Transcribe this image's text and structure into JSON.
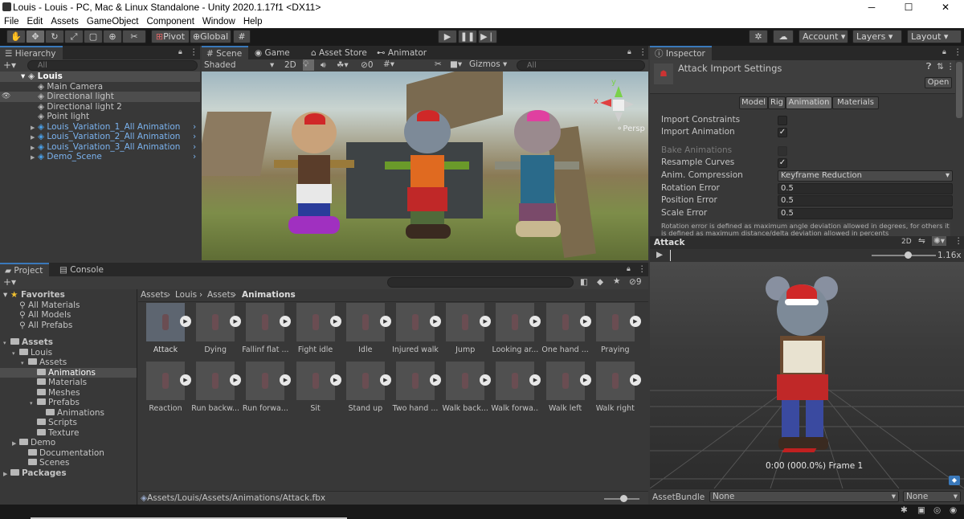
{
  "window": {
    "title": "Louis - Louis - PC, Mac & Linux Standalone - Unity 2020.1.17f1 <DX11>",
    "minimize": "─",
    "maximize": "☐",
    "close": "✕"
  },
  "menu": [
    "File",
    "Edit",
    "Assets",
    "GameObject",
    "Component",
    "Window",
    "Help"
  ],
  "toolbar": {
    "pivot": "Pivot",
    "global": "Global",
    "account": "Account",
    "layers": "Layers",
    "layout": "Layout"
  },
  "hierarchy": {
    "tab": "Hierarchy",
    "search_placeholder": "All",
    "root": "Louis",
    "items": [
      {
        "label": "Main Camera",
        "prefab": false,
        "expand": false
      },
      {
        "label": "Directional light",
        "prefab": false,
        "expand": false
      },
      {
        "label": "Directional light 2",
        "prefab": false,
        "expand": false
      },
      {
        "label": "Point light",
        "prefab": false,
        "expand": false
      },
      {
        "label": "Louis_Variation_1_All Animation",
        "prefab": true,
        "expand": true
      },
      {
        "label": "Louis_Variation_2_All Animation",
        "prefab": true,
        "expand": true
      },
      {
        "label": "Louis_Variation_3_All Animation",
        "prefab": true,
        "expand": true
      },
      {
        "label": "Demo_Scene",
        "prefab": true,
        "expand": true
      }
    ]
  },
  "scene": {
    "tabs": [
      "Scene",
      "Game",
      "Asset Store",
      "Animator"
    ],
    "shading": "Shaded",
    "mode2d": "2D",
    "hidden_count": "0",
    "gizmos": "Gizmos",
    "search_placeholder": "All",
    "axis_y": "y",
    "axis_x": "x",
    "persp": "Persp"
  },
  "project": {
    "tabs": [
      "Project",
      "Console"
    ],
    "hidden_count": "9",
    "favorites": {
      "label": "Favorites",
      "items": [
        "All Materials",
        "All Models",
        "All Prefabs"
      ]
    },
    "tree": [
      {
        "label": "Assets",
        "indent": 0,
        "bold": true
      },
      {
        "label": "Louis",
        "indent": 1
      },
      {
        "label": "Assets",
        "indent": 2
      },
      {
        "label": "Animations",
        "indent": 3,
        "selected": true
      },
      {
        "label": "Materials",
        "indent": 3
      },
      {
        "label": "Meshes",
        "indent": 3
      },
      {
        "label": "Prefabs",
        "indent": 3
      },
      {
        "label": "Animations",
        "indent": 4
      },
      {
        "label": "Scripts",
        "indent": 3
      },
      {
        "label": "Texture",
        "indent": 3
      },
      {
        "label": "Demo",
        "indent": 1
      },
      {
        "label": "Documentation",
        "indent": 2
      },
      {
        "label": "Scenes",
        "indent": 2
      },
      {
        "label": "Packages",
        "indent": 0,
        "bold": true
      }
    ],
    "breadcrumb": [
      "Assets",
      "Louis",
      "Assets",
      "Animations"
    ],
    "assets_row1": [
      "Attack",
      "Dying",
      "Fallinf flat ...",
      "Fight idle",
      "Idle",
      "Injured walk",
      "Jump",
      "Looking ar...",
      "One hand ...",
      "Praying"
    ],
    "assets_row2": [
      "Reaction",
      "Run backw...",
      "Run forwa...",
      "Sit",
      "Stand up",
      "Two hand ...",
      "Walk back...",
      "Walk forwa...",
      "Walk left",
      "Walk right"
    ],
    "footer_path": "Assets/Louis/Assets/Animations/Attack.fbx"
  },
  "inspector": {
    "tab": "Inspector",
    "title": "Attack Import Settings",
    "open": "Open",
    "subtabs": [
      "Model",
      "Rig",
      "Animation",
      "Materials"
    ],
    "props": [
      {
        "label": "Import Constraints",
        "type": "check",
        "value": ""
      },
      {
        "label": "Import Animation",
        "type": "check",
        "value": "✓"
      },
      {
        "label": "Bake Animations",
        "type": "check",
        "value": "",
        "disabled": true
      },
      {
        "label": "Resample Curves",
        "type": "check",
        "value": "✓"
      },
      {
        "label": "Anim. Compression",
        "type": "dropdown",
        "value": "Keyframe Reduction"
      },
      {
        "label": "Rotation Error",
        "type": "field",
        "value": "0.5"
      },
      {
        "label": "Position Error",
        "type": "field",
        "value": "0.5"
      },
      {
        "label": "Scale Error",
        "type": "field",
        "value": "0.5"
      }
    ],
    "help": "Rotation error is defined as maximum angle deviation allowed in degrees, for others it is defined as maximum distance/delta deviation allowed in percents",
    "preview_title": "Attack",
    "preview_2d": "2D",
    "speed": "1.16x",
    "frame": "0:00 (000.0%) Frame 1",
    "assetbundle_label": "AssetBundle",
    "assetbundle_value": "None",
    "assetbundle_variant": "None"
  },
  "colors": {
    "accent": "#3a79bb",
    "prefab": "#7bb3ef",
    "bg": "#383838"
  }
}
